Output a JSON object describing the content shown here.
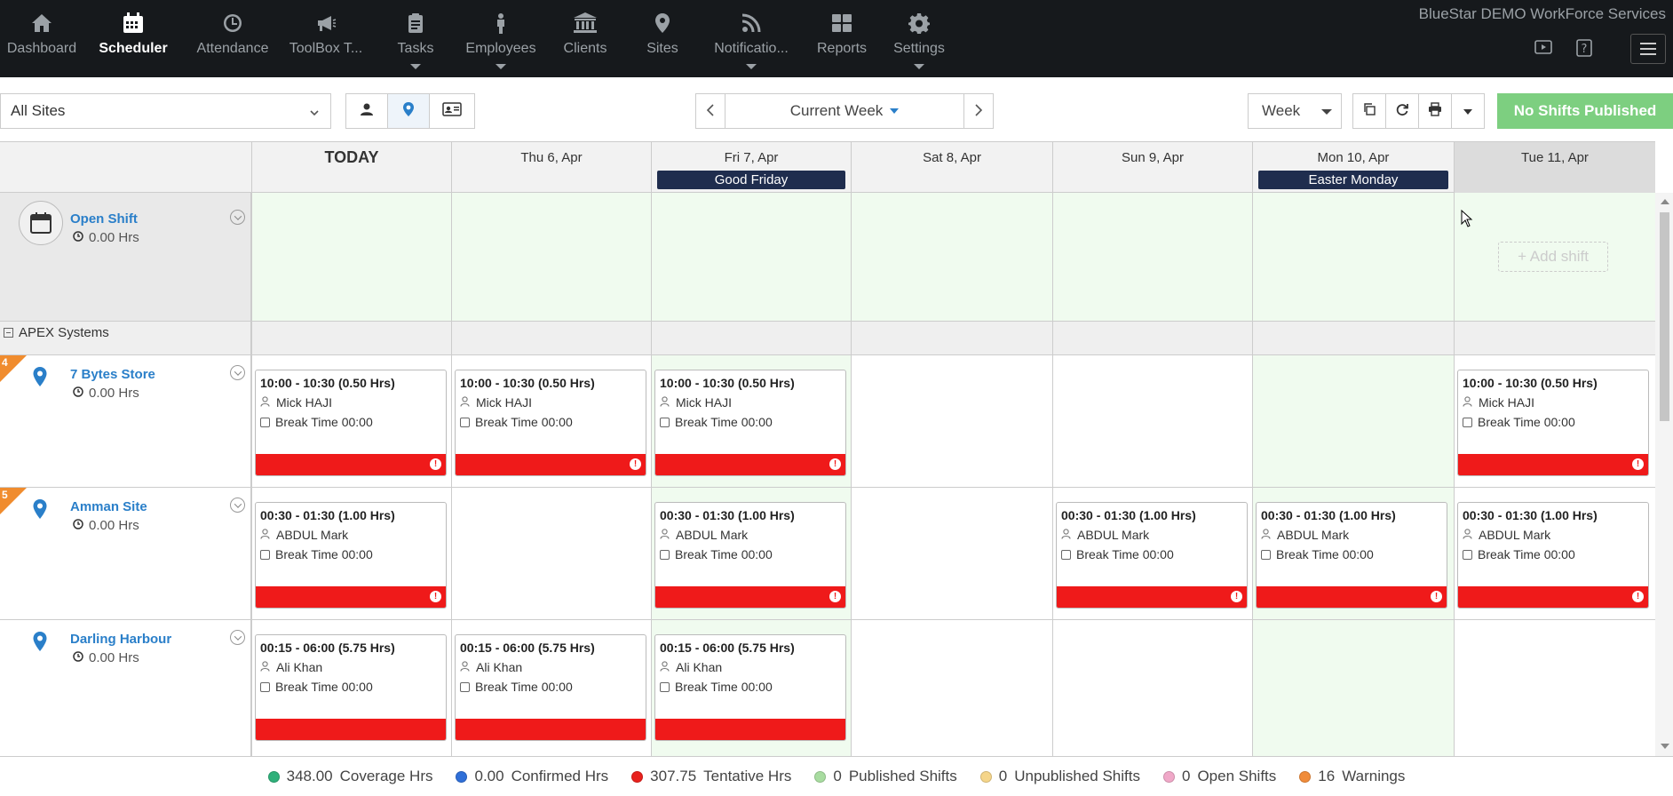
{
  "nav": {
    "items": [
      {
        "label": "Dashboard",
        "icon": "home-icon"
      },
      {
        "label": "Scheduler",
        "icon": "calendar-icon",
        "active": true
      },
      {
        "label": "Attendance",
        "icon": "clock-icon"
      },
      {
        "label": "ToolBox T...",
        "icon": "megaphone-icon"
      },
      {
        "label": "Tasks",
        "icon": "clipboard-icon",
        "dropdown": true
      },
      {
        "label": "Employees",
        "icon": "person-icon",
        "dropdown": true
      },
      {
        "label": "Clients",
        "icon": "bank-icon"
      },
      {
        "label": "Sites",
        "icon": "map-pin-icon"
      },
      {
        "label": "Notificatio...",
        "icon": "rss-icon",
        "dropdown": true
      },
      {
        "label": "Reports",
        "icon": "grid-icon"
      },
      {
        "label": "Settings",
        "icon": "gear-icon",
        "dropdown": true
      }
    ],
    "brand": "BlueStar DEMO WorkForce Services"
  },
  "toolbar": {
    "site_filter": "All Sites",
    "week_label": "Current Week",
    "range": "Week",
    "publish_label": "No Shifts Published"
  },
  "days": [
    {
      "label": "TODAY",
      "today": true
    },
    {
      "label": "Thu 6, Apr"
    },
    {
      "label": "Fri 7, Apr",
      "holiday": "Good Friday"
    },
    {
      "label": "Sat 8, Apr"
    },
    {
      "label": "Sun 9, Apr"
    },
    {
      "label": "Mon 10, Apr",
      "holiday": "Easter Monday"
    },
    {
      "label": "Tue 11, Apr",
      "highlight": true
    }
  ],
  "open_shift": {
    "name": "Open Shift",
    "hours": "0.00 Hrs",
    "add_label": "+ Add shift"
  },
  "group": {
    "name": "APEX Systems"
  },
  "sites": [
    {
      "name": "7 Bytes Store",
      "hours": "0.00 Hrs",
      "badge": "4",
      "shifts": [
        {
          "day": 0,
          "time": "10:00 - 10:30 (0.50 Hrs)",
          "employee": "Mick HAJI",
          "break": "Break Time 00:00",
          "warning": true
        },
        {
          "day": 1,
          "time": "10:00 - 10:30 (0.50 Hrs)",
          "employee": "Mick HAJI",
          "break": "Break Time 00:00",
          "warning": true
        },
        {
          "day": 2,
          "time": "10:00 - 10:30 (0.50 Hrs)",
          "employee": "Mick HAJI",
          "break": "Break Time 00:00",
          "warning": true
        },
        {
          "day": 6,
          "time": "10:00 - 10:30 (0.50 Hrs)",
          "employee": "Mick HAJI",
          "break": "Break Time 00:00",
          "warning": true
        }
      ]
    },
    {
      "name": "Amman Site",
      "hours": "0.00 Hrs",
      "badge": "5",
      "shifts": [
        {
          "day": 0,
          "time": "00:30 - 01:30 (1.00 Hrs)",
          "employee": "ABDUL Mark",
          "break": "Break Time 00:00",
          "warning": true
        },
        {
          "day": 2,
          "time": "00:30 - 01:30 (1.00 Hrs)",
          "employee": "ABDUL Mark",
          "break": "Break Time 00:00",
          "warning": true
        },
        {
          "day": 4,
          "time": "00:30 - 01:30 (1.00 Hrs)",
          "employee": "ABDUL Mark",
          "break": "Break Time 00:00",
          "warning": true
        },
        {
          "day": 5,
          "time": "00:30 - 01:30 (1.00 Hrs)",
          "employee": "ABDUL Mark",
          "break": "Break Time 00:00",
          "warning": true
        },
        {
          "day": 6,
          "time": "00:30 - 01:30 (1.00 Hrs)",
          "employee": "ABDUL Mark",
          "break": "Break Time 00:00",
          "warning": true
        }
      ]
    },
    {
      "name": "Darling Harbour",
      "hours": "0.00 Hrs",
      "badge": "",
      "shifts": [
        {
          "day": 0,
          "time": "00:15 - 06:00 (5.75 Hrs)",
          "employee": "Ali Khan",
          "break": "Break Time 00:00",
          "warning": false
        },
        {
          "day": 1,
          "time": "00:15 - 06:00 (5.75 Hrs)",
          "employee": "Ali Khan",
          "break": "Break Time 00:00",
          "warning": false
        },
        {
          "day": 2,
          "time": "00:15 - 06:00 (5.75 Hrs)",
          "employee": "Ali Khan",
          "break": "Break Time 00:00",
          "warning": false
        }
      ]
    }
  ],
  "footer": [
    {
      "value": "348.00",
      "label": "Coverage Hrs",
      "color": "#2fb07a"
    },
    {
      "value": "0.00",
      "label": "Confirmed Hrs",
      "color": "#2f6fd8"
    },
    {
      "value": "307.75",
      "label": "Tentative Hrs",
      "color": "#e8211d"
    },
    {
      "value": "0",
      "label": "Published Shifts",
      "color": "#a8dca0"
    },
    {
      "value": "0",
      "label": "Unpublished Shifts",
      "color": "#f5d58a"
    },
    {
      "value": "0",
      "label": "Open Shifts",
      "color": "#f0a8c8"
    },
    {
      "value": "16",
      "label": "Warnings",
      "color": "#f08c3a"
    }
  ]
}
